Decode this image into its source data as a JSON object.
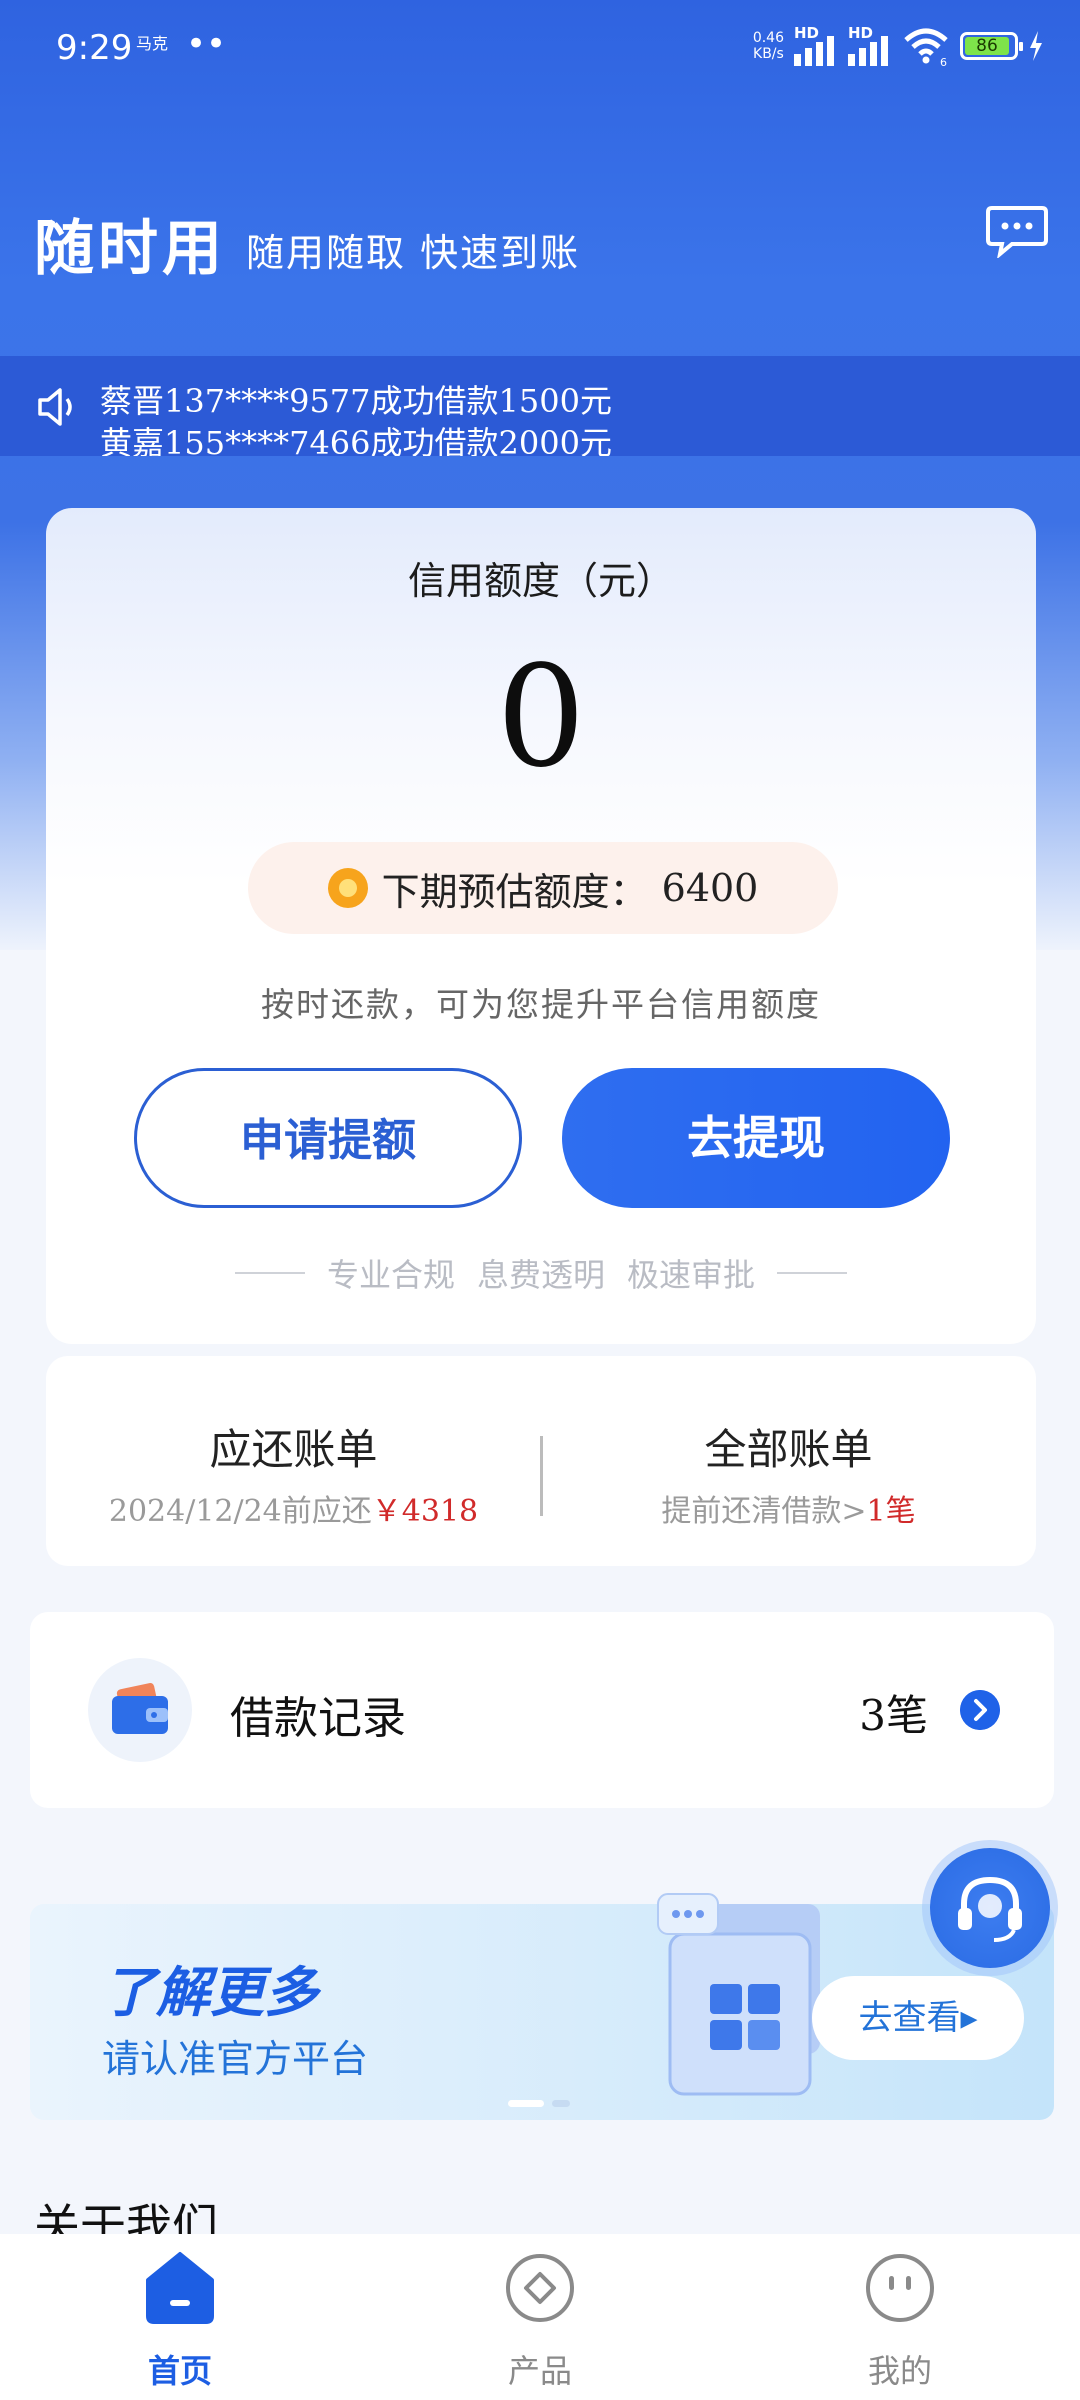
{
  "status_bar": {
    "time": "9:29",
    "notify": "马克",
    "dots": "••",
    "speed_value": "0.46",
    "speed_unit": "KB/s",
    "signal_label_1": "HD",
    "signal_label_2": "HD",
    "wifi_badge": "6",
    "battery": "86"
  },
  "header": {
    "title": "随时用",
    "subtitle": "随用随取 快速到账"
  },
  "notice": {
    "lines": [
      "蔡晋137****9577成功借款1500元",
      "黄嘉155****7466成功借款2000元"
    ]
  },
  "credit_card": {
    "label": "信用额度（元）",
    "value": "0",
    "estimate_label": "下期预估额度：",
    "estimate_value": "6400",
    "hint": "按时还款，可为您提升平台信用额度",
    "apply_button": "申请提额",
    "withdraw_button": "去提现",
    "slogans": [
      "专业合规",
      "息费透明",
      "极速审批"
    ]
  },
  "bills": {
    "due_title": "应还账单",
    "due_date": "2024/12/24前应还",
    "due_amount": "￥4318",
    "all_title": "全部账单",
    "all_sub": "提前还清借款>",
    "all_count": "1笔"
  },
  "loan_records": {
    "title": "借款记录",
    "count": "3笔"
  },
  "banner": {
    "title": "了解更多",
    "subtitle": "请认准官方平台",
    "button": "去查看▸"
  },
  "about": {
    "title": "关于我们"
  },
  "tabbar": {
    "items": [
      {
        "label": "首页"
      },
      {
        "label": "产品"
      },
      {
        "label": "我的"
      }
    ]
  },
  "colors": {
    "primary": "#2263f0",
    "header_blue": "#2f63e0",
    "due_red": "#d12a2a"
  }
}
